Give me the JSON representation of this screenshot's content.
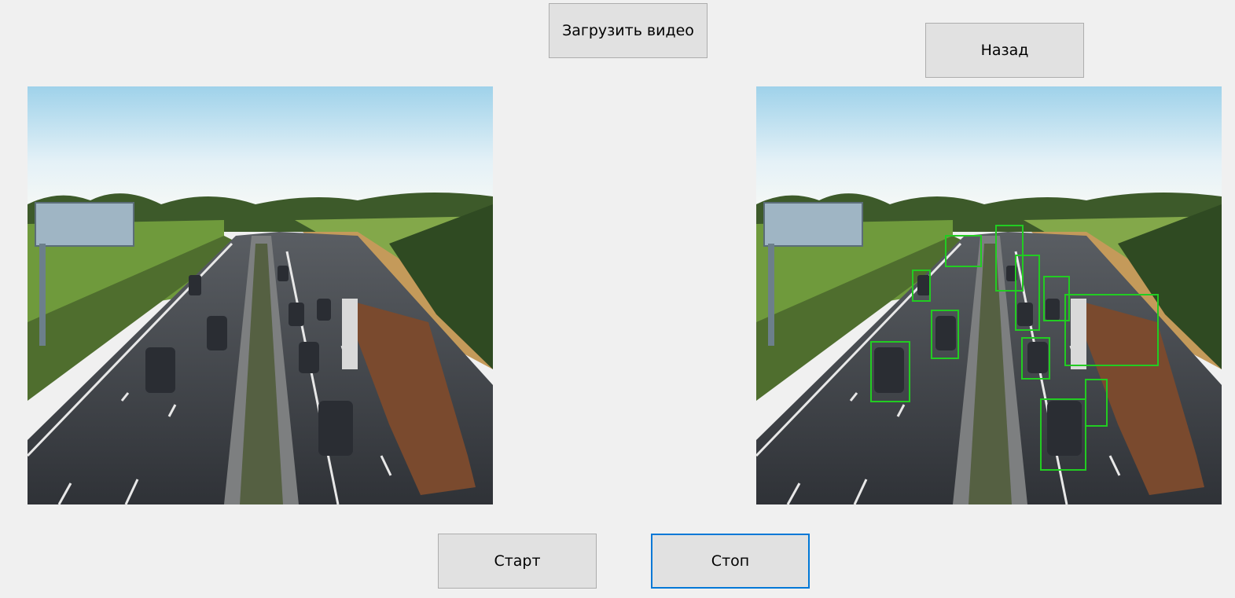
{
  "buttons": {
    "load": "Загрузить видео",
    "back": "Назад",
    "start": "Старт",
    "stop": "Стоп"
  },
  "colors": {
    "window_bg": "#f0f0f0",
    "button_bg": "#e1e1e1",
    "button_border": "#adadad",
    "focus_border": "#0078d7",
    "detection_box": "#22cc22"
  },
  "videos": {
    "source": "original-traffic-video-frame",
    "detected": "processed-traffic-video-frame-with-vehicle-detections"
  }
}
